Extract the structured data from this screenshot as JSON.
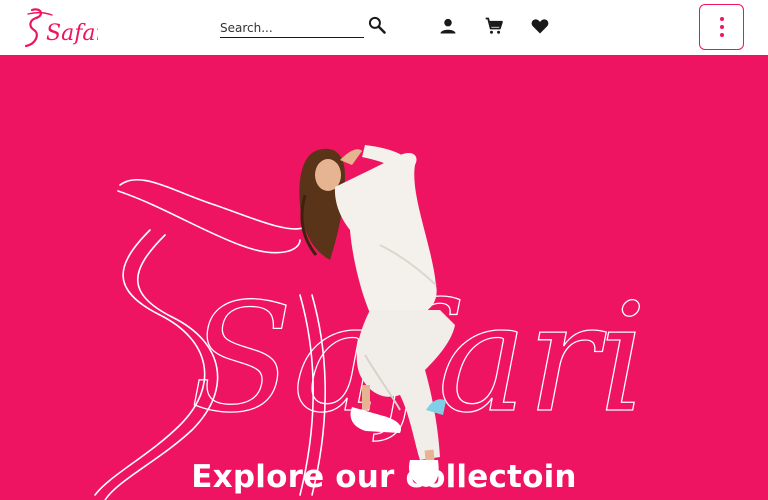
{
  "brand": {
    "logo_text": "Safari"
  },
  "header": {
    "search": {
      "placeholder": "Search...",
      "value": ""
    },
    "icons": {
      "search": "search-icon",
      "account": "user-icon",
      "cart": "cart-icon",
      "wishlist": "heart-icon",
      "menu": "more-vertical-icon"
    }
  },
  "hero": {
    "wordmark": "Safari",
    "title": "Explore our collectoin"
  },
  "colors": {
    "brand": "#ef1461",
    "header_bg": "#ffffff",
    "icon": "#1a1a1a"
  }
}
